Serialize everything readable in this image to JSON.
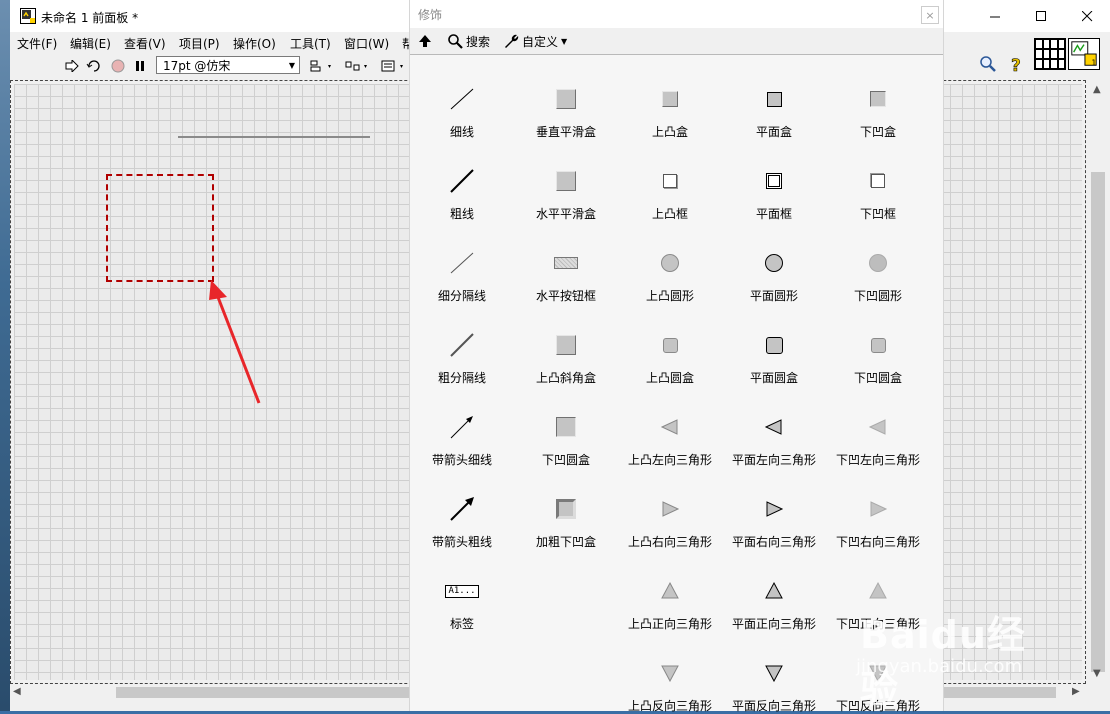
{
  "window": {
    "title": "未命名 1 前面板 *"
  },
  "menu": [
    "文件(F)",
    "编辑(E)",
    "查看(V)",
    "项目(P)",
    "操作(O)",
    "工具(T)",
    "窗口(W)",
    "帮"
  ],
  "toolbar": {
    "font": "17pt @仿宋"
  },
  "palette": {
    "title": "修饰",
    "search_label": "搜索",
    "customize_label": "自定义",
    "items": [
      [
        "细线",
        "垂直平滑盒",
        "上凸盒",
        "平面盒",
        "下凹盒"
      ],
      [
        "粗线",
        "水平平滑盒",
        "上凸框",
        "平面框",
        "下凹框"
      ],
      [
        "细分隔线",
        "水平按钮框",
        "上凸圆形",
        "平面圆形",
        "下凹圆形"
      ],
      [
        "粗分隔线",
        "上凸斜角盒",
        "上凸圆盒",
        "平面圆盒",
        "下凹圆盒"
      ],
      [
        "带箭头细线",
        "下凹圆盒",
        "上凸左向三角形",
        "平面左向三角形",
        "下凹左向三角形"
      ],
      [
        "带箭头粗线",
        "加粗下凹盒",
        "上凸右向三角形",
        "平面右向三角形",
        "下凹右向三角形"
      ],
      [
        "标签",
        "",
        "上凸正向三角形",
        "平面正向三角形",
        "下凹正向三角形"
      ],
      [
        "",
        "",
        "上凸反向三角形",
        "平面反向三角形",
        "下凹反向三角形"
      ]
    ],
    "label_icon_text": "A1..."
  },
  "watermark": {
    "line1": "Baidu经验",
    "line2": "jingyan.baidu.com"
  },
  "colors": {
    "selection": "#b00000",
    "arrow": "#e8262a"
  }
}
